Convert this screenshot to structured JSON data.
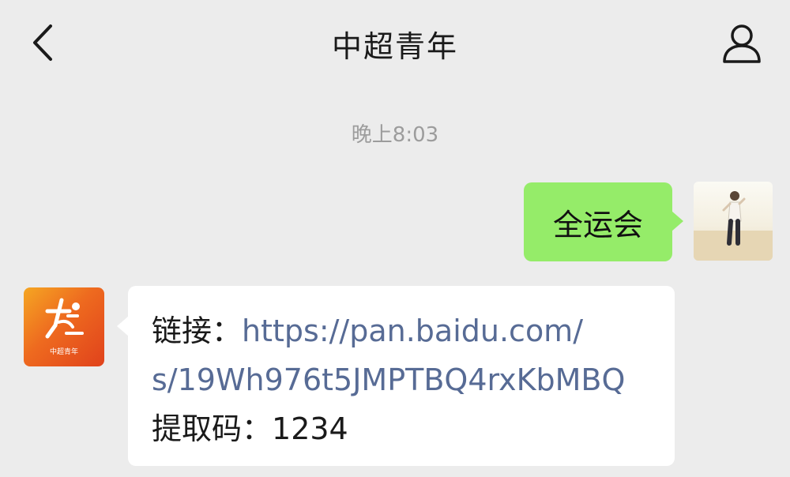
{
  "header": {
    "title": "中超青年",
    "back_icon": "chevron-left-icon",
    "profile_icon": "person-icon"
  },
  "chat": {
    "timestamp": "晚上8:03",
    "outgoing": {
      "text": "全运会",
      "bubble_color": "#95ec69"
    },
    "incoming": {
      "link_label": "链接：",
      "link_part1": "https://pan.baidu.com/",
      "link_part2": "s/19Wh976t5JMPTBQ4rxKbMBQ",
      "code_label": "提取码：",
      "code_value": "1234",
      "link_color": "#576b95"
    },
    "bot_avatar_caption": "中超青年"
  }
}
